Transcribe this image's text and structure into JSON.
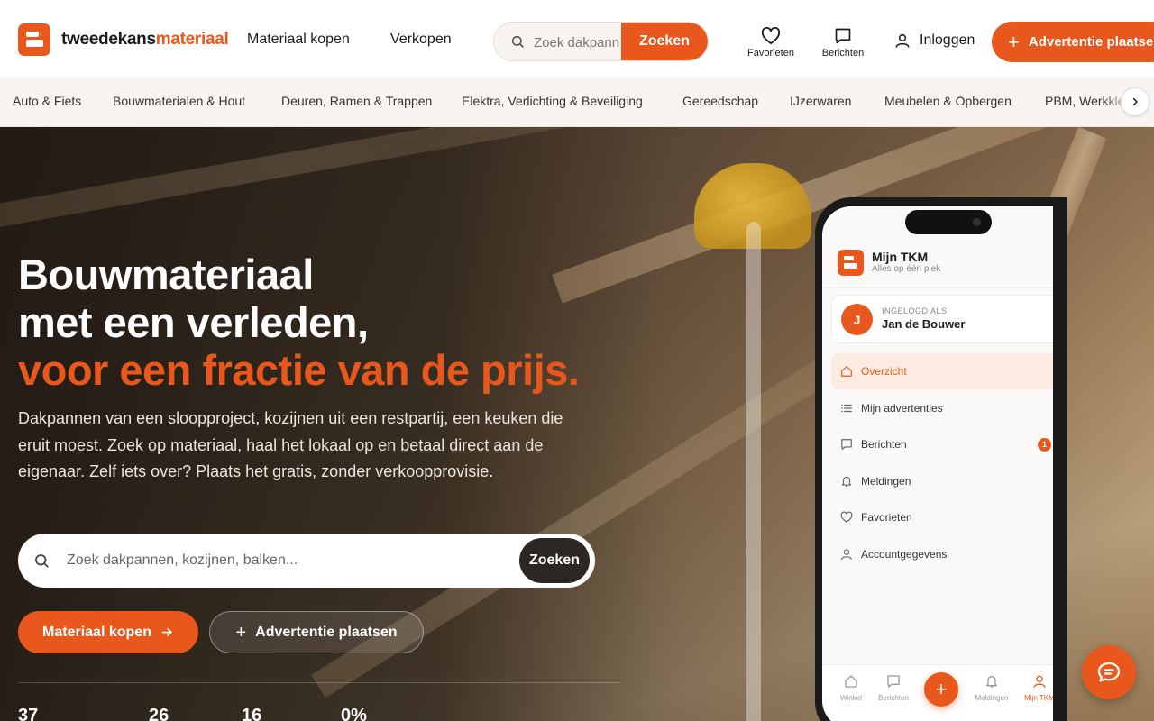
{
  "header": {
    "logo_part1": "tweedekans",
    "logo_part2": "materiaal",
    "nav_buy": "Materiaal kopen",
    "nav_sell": "Verkopen",
    "search_placeholder": "Zoek dakpannen, kozijnen, balken...",
    "search_button": "Zoeken",
    "favorites": "Favorieten",
    "messages": "Berichten",
    "login": "Inloggen",
    "place_ad": "Advertentie plaatsen"
  },
  "categories": [
    "Auto & Fiets",
    "Bouwmaterialen & Hout",
    "Deuren, Ramen & Trappen",
    "Elektra, Verlichting & Beveiliging",
    "Gereedschap",
    "IJzerwaren",
    "Meubelen & Opbergen",
    "PBM, Werkkleding"
  ],
  "hero": {
    "title_line1": "Bouwmateriaal",
    "title_line2": "met een verleden,",
    "title_line3": "voor een fractie van de prijs.",
    "lead": "Dakpannen van een sloopproject, kozijnen uit een restpartij, een keuken die eruit moest. Zoek op materiaal, haal het lokaal op en betaal direct aan de eigenaar. Zelf iets over? Plaats het gratis, zonder verkoopprovisie.",
    "search_placeholder": "Zoek dakpannen, kozijnen, balken...",
    "search_button": "Zoeken",
    "cta_buy": "Materiaal kopen",
    "cta_place": "Advertentie plaatsen",
    "stats": [
      "37",
      "26",
      "16",
      "0%"
    ]
  },
  "phone": {
    "app_title": "Mijn TKM",
    "app_subtitle": "Alles op één plek",
    "logged_in_label": "INGELOGD ALS",
    "user_initial": "J",
    "user_name": "Jan de Bouwer",
    "menu": [
      {
        "label": "Overzicht",
        "icon": "home-icon",
        "active": true
      },
      {
        "label": "Mijn advertenties",
        "icon": "list-icon"
      },
      {
        "label": "Berichten",
        "icon": "chat-icon",
        "badge": "1"
      },
      {
        "label": "Meldingen",
        "icon": "bell-icon"
      },
      {
        "label": "Favorieten",
        "icon": "heart-icon"
      },
      {
        "label": "Accountgegevens",
        "icon": "user-icon"
      }
    ],
    "tabs": [
      "Winkel",
      "Berichten",
      "Meldingen",
      "Mijn TKM"
    ]
  },
  "colors": {
    "accent": "#e8581c",
    "dark": "#2b2824"
  }
}
